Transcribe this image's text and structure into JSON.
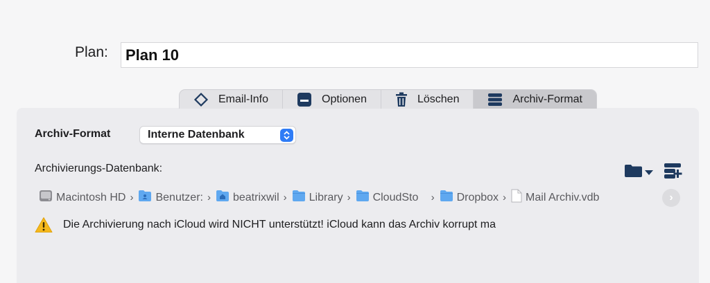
{
  "plan": {
    "label": "Plan:",
    "value": "Plan 10"
  },
  "tabs": [
    {
      "label": "Email-Info",
      "icon": "diamond-icon",
      "active": false
    },
    {
      "label": "Optionen",
      "icon": "options-icon",
      "active": false
    },
    {
      "label": "Löschen",
      "icon": "trash-icon",
      "active": false
    },
    {
      "label": "Archiv-Format",
      "icon": "database-icon",
      "active": true
    }
  ],
  "archive_format": {
    "label": "Archiv-Format",
    "selected": "Interne Datenbank"
  },
  "database": {
    "label": "Archivierungs-Datenbank:"
  },
  "path": [
    {
      "name": "Macintosh HD",
      "icon": "hard-drive-icon"
    },
    {
      "name": "Benutzer:",
      "icon": "users-folder-icon"
    },
    {
      "name": "beatrixwil",
      "icon": "home-folder-icon"
    },
    {
      "name": "Library",
      "icon": "folder-icon"
    },
    {
      "name": "CloudSto",
      "icon": "folder-icon"
    },
    {
      "name": "Dropbox",
      "icon": "folder-icon"
    },
    {
      "name": "Mail Archiv.vdb",
      "icon": "document-icon"
    }
  ],
  "warning": {
    "icon": "warning-icon",
    "text": "Die Archivierung nach iCloud wird NICHT unterstützt! iCloud kann das Archiv korrupt ma"
  },
  "colors": {
    "accent": "#2f7cf6",
    "folder": "#5fa8f0",
    "dark_icon": "#1e3a5f",
    "warning": "#f5b81c"
  }
}
